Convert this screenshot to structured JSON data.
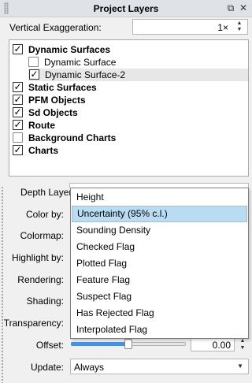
{
  "panel": {
    "title": "Project Layers",
    "buttons": {
      "float": "⧉",
      "close": "✕"
    }
  },
  "vertical_exaggeration": {
    "label": "Vertical Exaggeration:",
    "value": "1×"
  },
  "layers": [
    {
      "label": "Dynamic Surfaces",
      "checked": true,
      "bold": true,
      "indent": 0,
      "selected": false
    },
    {
      "label": "Dynamic Surface",
      "checked": false,
      "bold": false,
      "indent": 1,
      "selected": false
    },
    {
      "label": "Dynamic Surface-2",
      "checked": true,
      "bold": false,
      "indent": 1,
      "selected": true
    },
    {
      "label": "Static Surfaces",
      "checked": true,
      "bold": true,
      "indent": 0,
      "selected": false
    },
    {
      "label": "PFM Objects",
      "checked": true,
      "bold": true,
      "indent": 0,
      "selected": false
    },
    {
      "label": "Sd Objects",
      "checked": true,
      "bold": true,
      "indent": 0,
      "selected": false
    },
    {
      "label": "Route",
      "checked": true,
      "bold": true,
      "indent": 0,
      "selected": false
    },
    {
      "label": "Background Charts",
      "checked": false,
      "bold": true,
      "indent": 0,
      "selected": false
    },
    {
      "label": "Charts",
      "checked": true,
      "bold": true,
      "indent": 0,
      "selected": false
    }
  ],
  "properties": {
    "depth_layer": "Depth Layer:",
    "color_by": "Color by:",
    "colormap": "Colormap:",
    "highlight_by": "Highlight by:",
    "rendering": "Rendering:",
    "shading": "Shading:",
    "transparency": "Transparency:",
    "offset": "Offset:",
    "update": "Update:"
  },
  "depth_layer_dropdown": {
    "selected": "Uncertainty (95% c.l.)",
    "options": [
      "Height",
      "Uncertainty (95% c.l.)",
      "Sounding Density",
      "Checked Flag",
      "Plotted Flag",
      "Feature Flag",
      "Suspect Flag",
      "Has Rejected Flag",
      "Interpolated Flag"
    ]
  },
  "offset": {
    "value": "0.00",
    "slider_fraction": 0.5
  },
  "update": {
    "value": "Always"
  },
  "icons": {
    "check": "✓",
    "spin_up": "▲",
    "spin_down": "▼",
    "combo_caret": "▼"
  },
  "colors": {
    "selection": "#b9dcf3",
    "slider_fill": "#4a90d9",
    "title_bar": "#dfe3e8"
  }
}
